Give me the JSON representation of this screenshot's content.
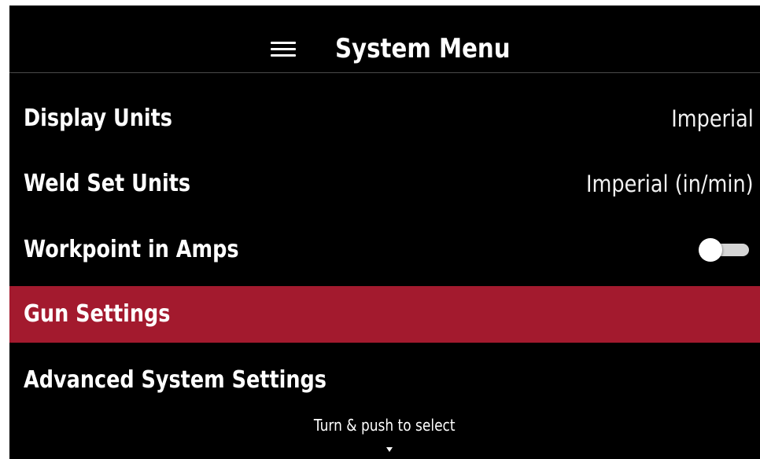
{
  "header": {
    "menu_icon": "hamburger-menu-icon",
    "title": "System Menu"
  },
  "menu": {
    "items": [
      {
        "label": "Display Units",
        "value": "Imperial"
      },
      {
        "label": "Weld Set Units",
        "value": "Imperial (in/min)"
      },
      {
        "label": "Workpoint in Amps",
        "toggle": "off"
      },
      {
        "label": "Gun Settings",
        "selected": true
      },
      {
        "label": "Advanced System Settings"
      }
    ]
  },
  "footer": {
    "hint": "Turn & push to select",
    "scroll_icon": "chevron-down-icon"
  },
  "colors": {
    "background": "#000000",
    "selected_row": "#a31a2e",
    "text": "#ffffff"
  }
}
